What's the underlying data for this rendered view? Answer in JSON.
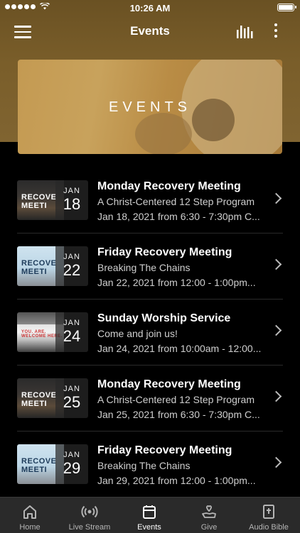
{
  "status_bar": {
    "time": "10:26 AM"
  },
  "header": {
    "title": "Events"
  },
  "hero": {
    "text": "EVENTS"
  },
  "events": [
    {
      "title": "Monday Recovery Meeting",
      "subtitle": "A Christ-Centered 12 Step Program",
      "when": "Jan 18, 2021 from 6:30 - 7:30pm C...",
      "month": "JAN",
      "day": "18",
      "thumb_text": "RECOVE MEETI"
    },
    {
      "title": "Friday Recovery Meeting",
      "subtitle": "Breaking The Chains",
      "when": "Jan 22, 2021 from 12:00 - 1:00pm...",
      "month": "JAN",
      "day": "22",
      "thumb_text": "RECOVE MEETI"
    },
    {
      "title": "Sunday Worship Service",
      "subtitle": "Come and join us!",
      "when": "Jan 24, 2021 from 10:00am - 12:00...",
      "month": "JAN",
      "day": "24",
      "thumb_text": "YOU. ARE. WELCOME HERE."
    },
    {
      "title": "Monday Recovery Meeting",
      "subtitle": "A Christ-Centered 12 Step Program",
      "when": "Jan 25, 2021 from 6:30 - 7:30pm C...",
      "month": "JAN",
      "day": "25",
      "thumb_text": "RECOVE MEETI"
    },
    {
      "title": "Friday Recovery Meeting",
      "subtitle": "Breaking The Chains",
      "when": "Jan 29, 2021 from 12:00 - 1:00pm...",
      "month": "JAN",
      "day": "29",
      "thumb_text": "RECOVE MEETI"
    }
  ],
  "tabs": [
    {
      "label": "Home",
      "icon": "home-icon"
    },
    {
      "label": "Live Stream",
      "icon": "broadcast-icon"
    },
    {
      "label": "Events",
      "icon": "calendar-icon",
      "active": true
    },
    {
      "label": "Give",
      "icon": "give-hand-heart-icon"
    },
    {
      "label": "Audio Bible",
      "icon": "bible-icon"
    }
  ]
}
